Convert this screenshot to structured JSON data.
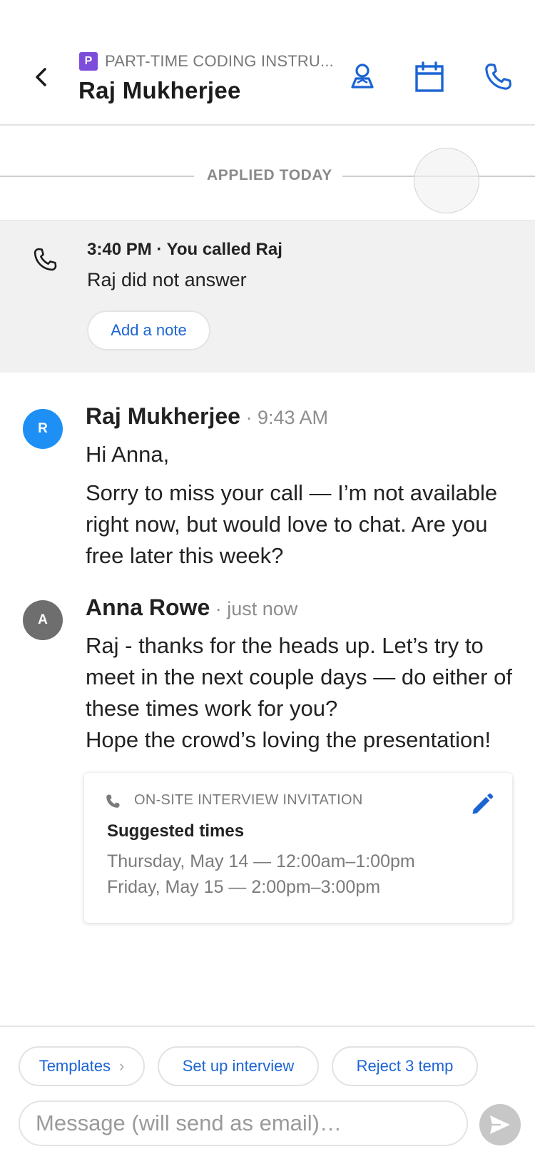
{
  "header": {
    "job_badge": "P",
    "job_title": "PART-TIME CODING INSTRU...",
    "candidate_name": "Raj Mukherjee",
    "icons": [
      "back-icon",
      "profile-icon",
      "calendar-icon",
      "phone-icon"
    ],
    "accent": "#1b64d4"
  },
  "timeline": {
    "applied_label": "APPLIED TODAY"
  },
  "call": {
    "title": "3:40 PM · You called Raj",
    "status": "Raj did not answer",
    "add_note_label": "Add a note"
  },
  "messages": [
    {
      "avatar": "R",
      "avatar_color": "#1e90f5",
      "name": "Raj Mukherjee",
      "time": " · 9:43 AM",
      "paragraphs": [
        "Hi Anna,",
        "Sorry to miss your call — I’m not available right now, but would love to chat. Are you free later this week?"
      ]
    },
    {
      "avatar": "A",
      "avatar_color": "#6e6e6e",
      "name": "Anna Rowe",
      "time": " · just now",
      "paragraphs": [
        "Raj - thanks for the heads up. Let’s try to meet in the next couple days — do either of these times work for you?",
        "Hope the crowd’s loving the presentation!"
      ]
    }
  ],
  "invite": {
    "label": "ON-SITE INTERVIEW INVITATION",
    "heading": "Suggested times",
    "times": [
      "Thursday, May 14 — 12:00am–1:00pm",
      "Friday, May 15 — 2:00pm–3:00pm"
    ]
  },
  "footer": {
    "chips": [
      "Templates",
      "Set up interview",
      "Reject 3 temp"
    ],
    "chip_chevron": "›",
    "message_placeholder": "Message (will send as email)…"
  }
}
